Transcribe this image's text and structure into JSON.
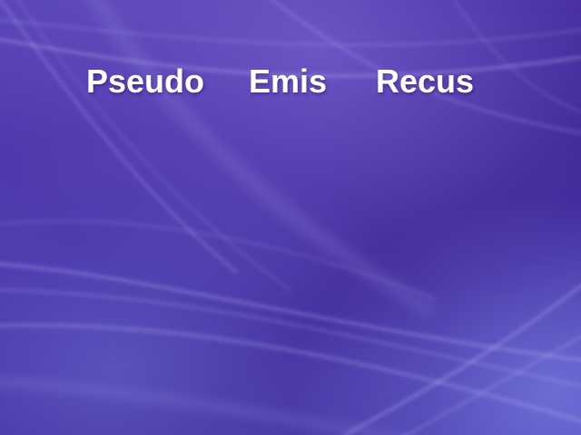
{
  "columns": [
    {
      "label": "Pseudo"
    },
    {
      "label": "Emis"
    },
    {
      "label": "Recus"
    }
  ],
  "theme": {
    "background_base": "#4a2fa0",
    "background_dark": "#3a1f8c",
    "background_light": "#6a5fd0",
    "text_color": "#ffffff"
  }
}
